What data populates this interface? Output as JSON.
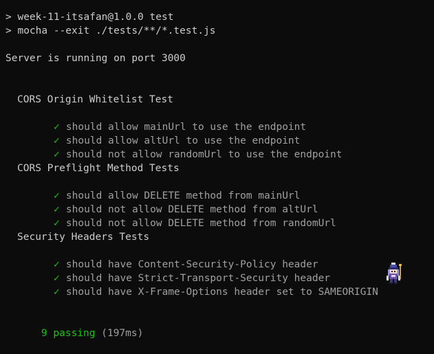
{
  "terminal": {
    "command_lines": [
      "> week-11-itsafan@1.0.0 test",
      "> mocha --exit ./tests/**/*.test.js"
    ],
    "server_message": "Server is running on port 3000",
    "suites": [
      {
        "title": "CORS Origin Whitelist Test",
        "tests": [
          "should allow mainUrl to use the endpoint",
          "should allow altUrl to use the endpoint",
          "should not allow randomUrl to use the endpoint"
        ]
      },
      {
        "title": "CORS Preflight Method Tests",
        "tests": [
          "should allow DELETE method from mainUrl",
          "should not allow DELETE method from altUrl",
          "should not allow DELETE method from randomUrl"
        ]
      },
      {
        "title": "Security Headers Tests",
        "tests": [
          "should have Content-Security-Policy header",
          "should have Strict-Transport-Security header",
          "should have X-Frame-Options header set to SAMEORIGIN"
        ]
      }
    ],
    "check_glyph": "✓",
    "summary": {
      "passing": "9 passing",
      "duration": "(197ms)"
    }
  },
  "colors": {
    "background": "#0c0c0c",
    "text": "#cccccc",
    "pass_green": "#16c60c",
    "dim_text": "#a0a0a0"
  },
  "icons": {
    "pet": "pixel-character-icon"
  }
}
